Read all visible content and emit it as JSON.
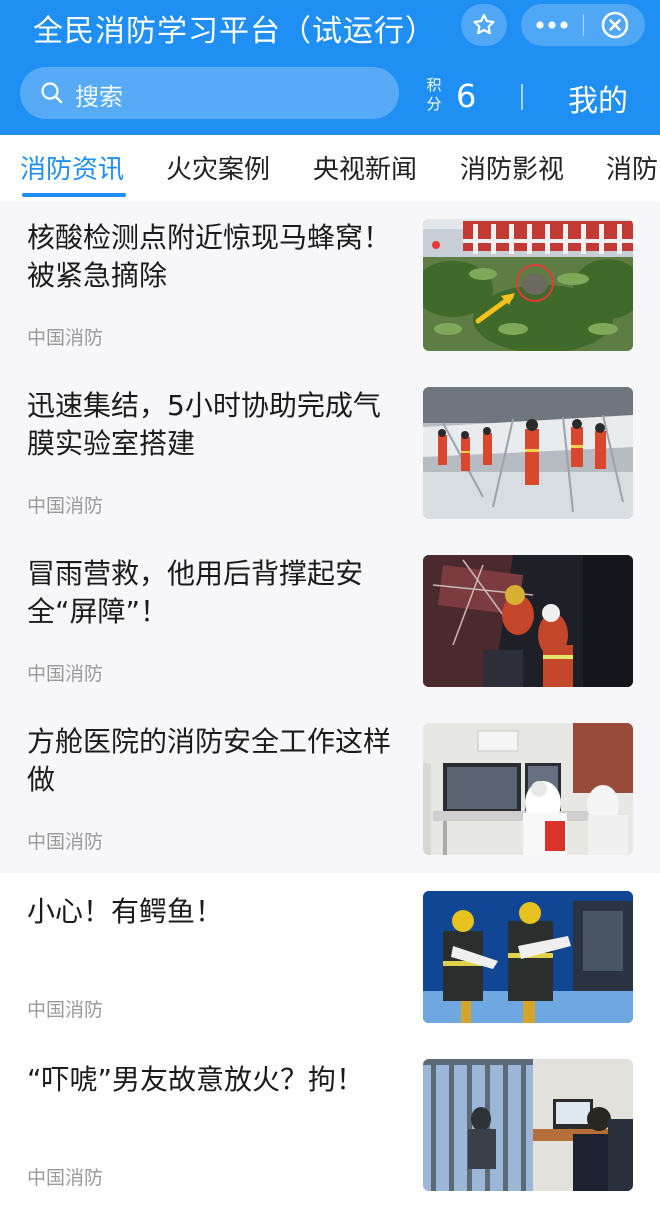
{
  "header": {
    "title": "全民消防学习平台（试运行）",
    "search_placeholder": "搜索",
    "points_label": "积分",
    "points_value": "6",
    "mine_label": "我的"
  },
  "tabs": [
    {
      "label": "消防资讯",
      "active": true
    },
    {
      "label": "火灾案例",
      "active": false
    },
    {
      "label": "央视新闻",
      "active": false
    },
    {
      "label": "消防影视",
      "active": false
    },
    {
      "label": "消防",
      "active": false
    }
  ],
  "articles": [
    {
      "title": "核酸检测点附近惊现马蜂窝！被紧急摘除",
      "source": "中国消防",
      "thumb_icon": "hornet-nest-photo"
    },
    {
      "title": "迅速集结，5小时协助完成气膜实验室搭建",
      "source": "中国消防",
      "thumb_icon": "firefighters-tent-photo"
    },
    {
      "title": "冒雨营救，他用后背撑起安全“屏障”！",
      "source": "中国消防",
      "thumb_icon": "night-rescue-photo"
    },
    {
      "title": "方舱医院的消防安全工作这样做",
      "source": "中国消防",
      "thumb_icon": "monitoring-room-photo"
    },
    {
      "title": "小心！有鳄鱼！",
      "source": "中国消防",
      "thumb_icon": "crocodile-rescue-photo"
    },
    {
      "title": "“吓唬”男友故意放火？拘！",
      "source": "中国消防",
      "thumb_icon": "detention-room-photo"
    }
  ],
  "colors": {
    "accent": "#1f8ff3",
    "source_text": "#9a9a9a"
  }
}
